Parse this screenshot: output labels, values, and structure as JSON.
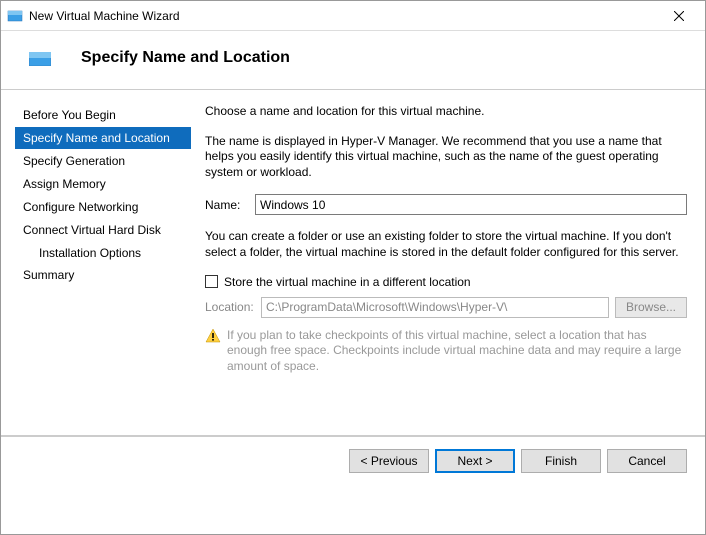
{
  "titlebar": {
    "title": "New Virtual Machine Wizard"
  },
  "header": {
    "title": "Specify Name and Location"
  },
  "sidebar": {
    "steps": {
      "s0": "Before You Begin",
      "s1": "Specify Name and Location",
      "s2": "Specify Generation",
      "s3": "Assign Memory",
      "s4": "Configure Networking",
      "s5": "Connect Virtual Hard Disk",
      "s5a": "Installation Options",
      "s6": "Summary"
    }
  },
  "content": {
    "intro": "Choose a name and location for this virtual machine.",
    "name_hint": "The name is displayed in Hyper-V Manager. We recommend that you use a name that helps you easily identify this virtual machine, such as the name of the guest operating system or workload.",
    "name_label": "Name:",
    "name_value": "Windows 10",
    "folder_hint": "You can create a folder or use an existing folder to store the virtual machine. If you don't select a folder, the virtual machine is stored in the default folder configured for this server.",
    "checkbox_label": "Store the virtual machine in a different location",
    "location_label": "Location:",
    "location_value": "C:\\ProgramData\\Microsoft\\Windows\\Hyper-V\\",
    "browse_label": "Browse...",
    "warning": "If you plan to take checkpoints of this virtual machine, select a location that has enough free space. Checkpoints include virtual machine data and may require a large amount of space."
  },
  "footer": {
    "previous": "< Previous",
    "next": "Next >",
    "finish": "Finish",
    "cancel": "Cancel"
  }
}
